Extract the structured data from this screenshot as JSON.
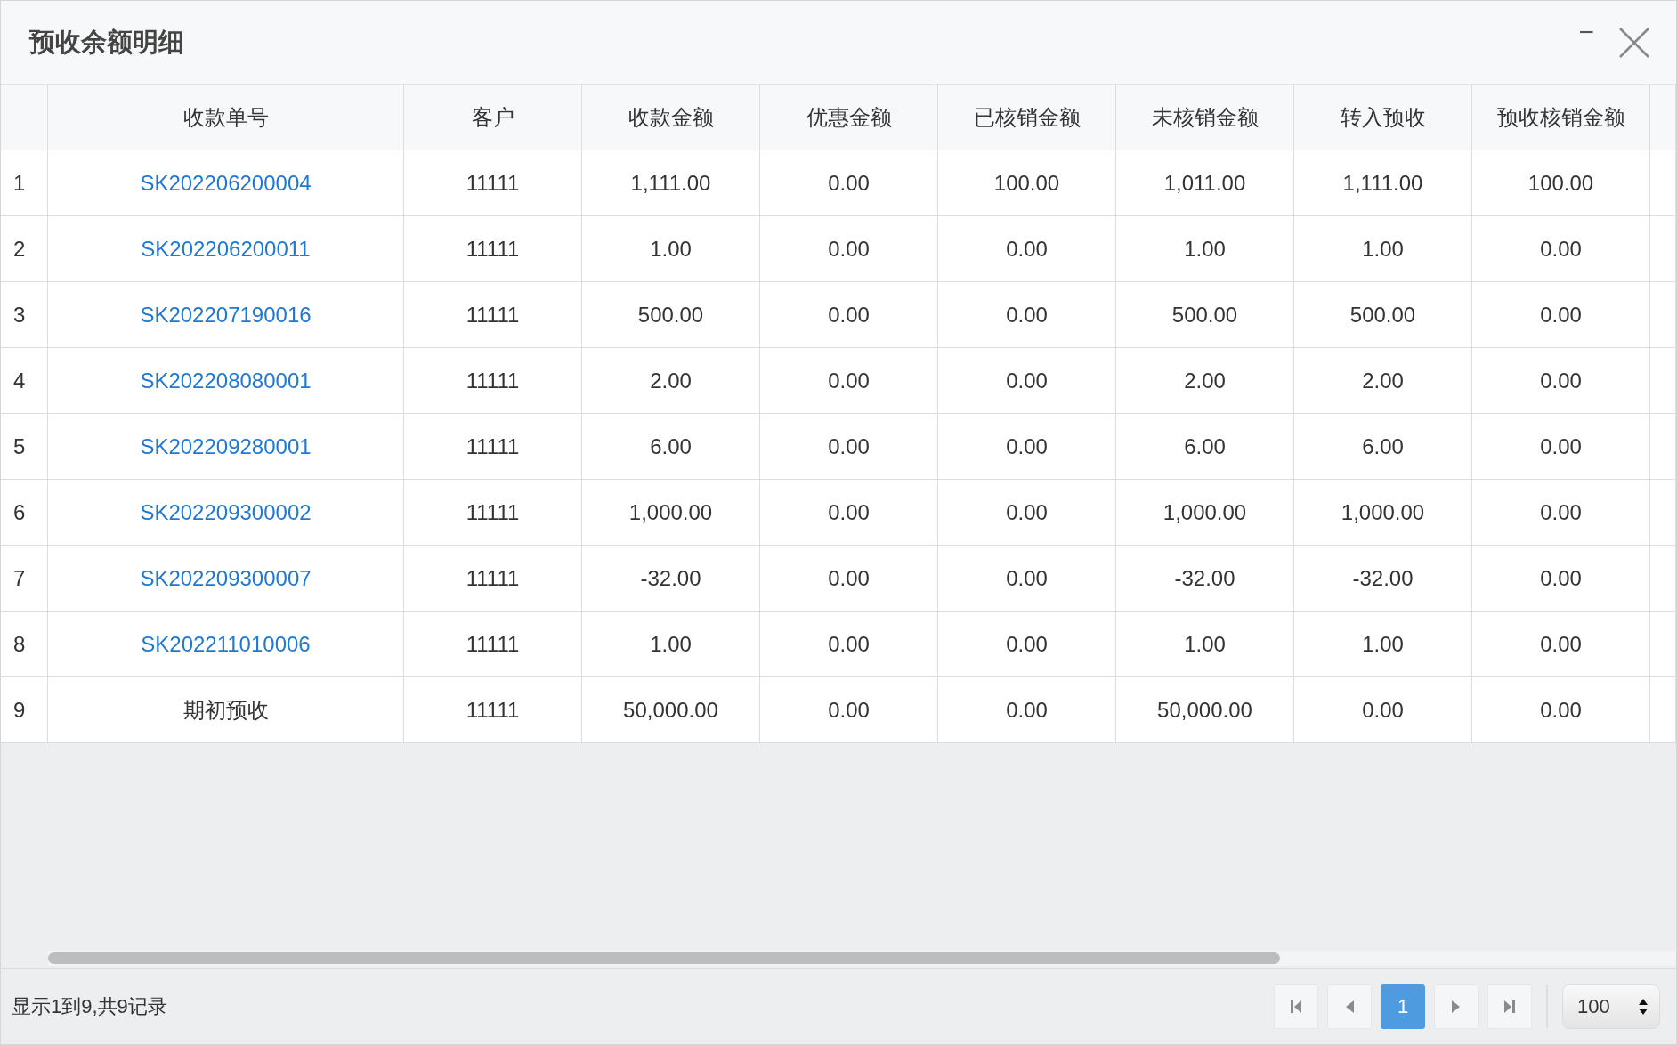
{
  "window": {
    "title": "预收余额明细",
    "minimize_glyph": "−"
  },
  "table": {
    "columns": [
      "收款单号",
      "客户",
      "收款金额",
      "优惠金额",
      "已核销金额",
      "未核销金额",
      "转入预收",
      "预收核销金额"
    ],
    "rows": [
      {
        "index": "1",
        "kind": "link",
        "cells": [
          "SK202206200004",
          "11111",
          "1,111.00",
          "0.00",
          "100.00",
          "1,011.00",
          "1,111.00",
          "100.00"
        ]
      },
      {
        "index": "2",
        "kind": "link",
        "cells": [
          "SK202206200011",
          "11111",
          "1.00",
          "0.00",
          "0.00",
          "1.00",
          "1.00",
          "0.00"
        ]
      },
      {
        "index": "3",
        "kind": "link",
        "cells": [
          "SK202207190016",
          "11111",
          "500.00",
          "0.00",
          "0.00",
          "500.00",
          "500.00",
          "0.00"
        ]
      },
      {
        "index": "4",
        "kind": "link",
        "cells": [
          "SK202208080001",
          "11111",
          "2.00",
          "0.00",
          "0.00",
          "2.00",
          "2.00",
          "0.00"
        ]
      },
      {
        "index": "5",
        "kind": "link",
        "cells": [
          "SK202209280001",
          "11111",
          "6.00",
          "0.00",
          "0.00",
          "6.00",
          "6.00",
          "0.00"
        ]
      },
      {
        "index": "6",
        "kind": "link",
        "cells": [
          "SK202209300002",
          "11111",
          "1,000.00",
          "0.00",
          "0.00",
          "1,000.00",
          "1,000.00",
          "0.00"
        ]
      },
      {
        "index": "7",
        "kind": "link",
        "cells": [
          "SK202209300007",
          "11111",
          "-32.00",
          "0.00",
          "0.00",
          "-32.00",
          "-32.00",
          "0.00"
        ]
      },
      {
        "index": "8",
        "kind": "link",
        "cells": [
          "SK202211010006",
          "11111",
          "1.00",
          "0.00",
          "0.00",
          "1.00",
          "1.00",
          "0.00"
        ]
      },
      {
        "index": "9",
        "kind": "text",
        "cells": [
          "期初预收",
          "11111",
          "50,000.00",
          "0.00",
          "0.00",
          "50,000.00",
          "0.00",
          "0.00"
        ]
      }
    ]
  },
  "footer": {
    "summary": "显示1到9,共9记录",
    "pages": [
      {
        "label": "1",
        "selected": true
      }
    ],
    "page_size": "100"
  }
}
